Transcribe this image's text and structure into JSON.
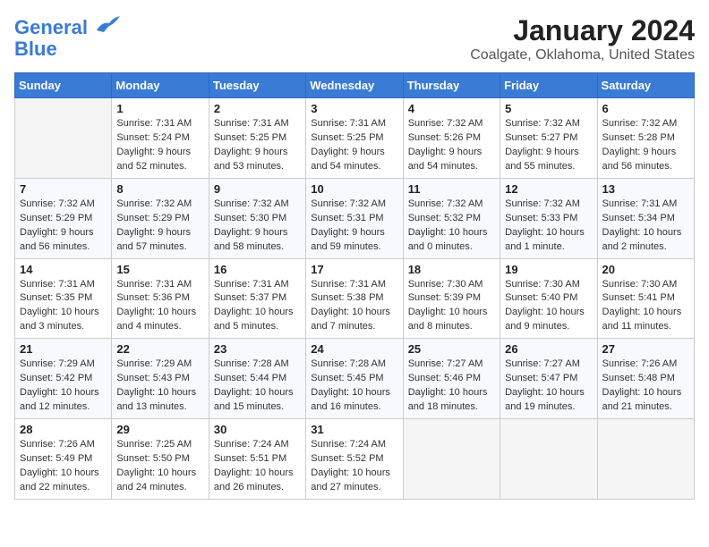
{
  "header": {
    "logo_line1": "General",
    "logo_line2": "Blue",
    "title": "January 2024",
    "subtitle": "Coalgate, Oklahoma, United States"
  },
  "days_of_week": [
    "Sunday",
    "Monday",
    "Tuesday",
    "Wednesday",
    "Thursday",
    "Friday",
    "Saturday"
  ],
  "weeks": [
    [
      {
        "day": "",
        "sunrise": "",
        "sunset": "",
        "daylight": ""
      },
      {
        "day": "1",
        "sunrise": "Sunrise: 7:31 AM",
        "sunset": "Sunset: 5:24 PM",
        "daylight": "Daylight: 9 hours and 52 minutes."
      },
      {
        "day": "2",
        "sunrise": "Sunrise: 7:31 AM",
        "sunset": "Sunset: 5:25 PM",
        "daylight": "Daylight: 9 hours and 53 minutes."
      },
      {
        "day": "3",
        "sunrise": "Sunrise: 7:31 AM",
        "sunset": "Sunset: 5:25 PM",
        "daylight": "Daylight: 9 hours and 54 minutes."
      },
      {
        "day": "4",
        "sunrise": "Sunrise: 7:32 AM",
        "sunset": "Sunset: 5:26 PM",
        "daylight": "Daylight: 9 hours and 54 minutes."
      },
      {
        "day": "5",
        "sunrise": "Sunrise: 7:32 AM",
        "sunset": "Sunset: 5:27 PM",
        "daylight": "Daylight: 9 hours and 55 minutes."
      },
      {
        "day": "6",
        "sunrise": "Sunrise: 7:32 AM",
        "sunset": "Sunset: 5:28 PM",
        "daylight": "Daylight: 9 hours and 56 minutes."
      }
    ],
    [
      {
        "day": "7",
        "sunrise": "Sunrise: 7:32 AM",
        "sunset": "Sunset: 5:29 PM",
        "daylight": "Daylight: 9 hours and 56 minutes."
      },
      {
        "day": "8",
        "sunrise": "Sunrise: 7:32 AM",
        "sunset": "Sunset: 5:29 PM",
        "daylight": "Daylight: 9 hours and 57 minutes."
      },
      {
        "day": "9",
        "sunrise": "Sunrise: 7:32 AM",
        "sunset": "Sunset: 5:30 PM",
        "daylight": "Daylight: 9 hours and 58 minutes."
      },
      {
        "day": "10",
        "sunrise": "Sunrise: 7:32 AM",
        "sunset": "Sunset: 5:31 PM",
        "daylight": "Daylight: 9 hours and 59 minutes."
      },
      {
        "day": "11",
        "sunrise": "Sunrise: 7:32 AM",
        "sunset": "Sunset: 5:32 PM",
        "daylight": "Daylight: 10 hours and 0 minutes."
      },
      {
        "day": "12",
        "sunrise": "Sunrise: 7:32 AM",
        "sunset": "Sunset: 5:33 PM",
        "daylight": "Daylight: 10 hours and 1 minute."
      },
      {
        "day": "13",
        "sunrise": "Sunrise: 7:31 AM",
        "sunset": "Sunset: 5:34 PM",
        "daylight": "Daylight: 10 hours and 2 minutes."
      }
    ],
    [
      {
        "day": "14",
        "sunrise": "Sunrise: 7:31 AM",
        "sunset": "Sunset: 5:35 PM",
        "daylight": "Daylight: 10 hours and 3 minutes."
      },
      {
        "day": "15",
        "sunrise": "Sunrise: 7:31 AM",
        "sunset": "Sunset: 5:36 PM",
        "daylight": "Daylight: 10 hours and 4 minutes."
      },
      {
        "day": "16",
        "sunrise": "Sunrise: 7:31 AM",
        "sunset": "Sunset: 5:37 PM",
        "daylight": "Daylight: 10 hours and 5 minutes."
      },
      {
        "day": "17",
        "sunrise": "Sunrise: 7:31 AM",
        "sunset": "Sunset: 5:38 PM",
        "daylight": "Daylight: 10 hours and 7 minutes."
      },
      {
        "day": "18",
        "sunrise": "Sunrise: 7:30 AM",
        "sunset": "Sunset: 5:39 PM",
        "daylight": "Daylight: 10 hours and 8 minutes."
      },
      {
        "day": "19",
        "sunrise": "Sunrise: 7:30 AM",
        "sunset": "Sunset: 5:40 PM",
        "daylight": "Daylight: 10 hours and 9 minutes."
      },
      {
        "day": "20",
        "sunrise": "Sunrise: 7:30 AM",
        "sunset": "Sunset: 5:41 PM",
        "daylight": "Daylight: 10 hours and 11 minutes."
      }
    ],
    [
      {
        "day": "21",
        "sunrise": "Sunrise: 7:29 AM",
        "sunset": "Sunset: 5:42 PM",
        "daylight": "Daylight: 10 hours and 12 minutes."
      },
      {
        "day": "22",
        "sunrise": "Sunrise: 7:29 AM",
        "sunset": "Sunset: 5:43 PM",
        "daylight": "Daylight: 10 hours and 13 minutes."
      },
      {
        "day": "23",
        "sunrise": "Sunrise: 7:28 AM",
        "sunset": "Sunset: 5:44 PM",
        "daylight": "Daylight: 10 hours and 15 minutes."
      },
      {
        "day": "24",
        "sunrise": "Sunrise: 7:28 AM",
        "sunset": "Sunset: 5:45 PM",
        "daylight": "Daylight: 10 hours and 16 minutes."
      },
      {
        "day": "25",
        "sunrise": "Sunrise: 7:27 AM",
        "sunset": "Sunset: 5:46 PM",
        "daylight": "Daylight: 10 hours and 18 minutes."
      },
      {
        "day": "26",
        "sunrise": "Sunrise: 7:27 AM",
        "sunset": "Sunset: 5:47 PM",
        "daylight": "Daylight: 10 hours and 19 minutes."
      },
      {
        "day": "27",
        "sunrise": "Sunrise: 7:26 AM",
        "sunset": "Sunset: 5:48 PM",
        "daylight": "Daylight: 10 hours and 21 minutes."
      }
    ],
    [
      {
        "day": "28",
        "sunrise": "Sunrise: 7:26 AM",
        "sunset": "Sunset: 5:49 PM",
        "daylight": "Daylight: 10 hours and 22 minutes."
      },
      {
        "day": "29",
        "sunrise": "Sunrise: 7:25 AM",
        "sunset": "Sunset: 5:50 PM",
        "daylight": "Daylight: 10 hours and 24 minutes."
      },
      {
        "day": "30",
        "sunrise": "Sunrise: 7:24 AM",
        "sunset": "Sunset: 5:51 PM",
        "daylight": "Daylight: 10 hours and 26 minutes."
      },
      {
        "day": "31",
        "sunrise": "Sunrise: 7:24 AM",
        "sunset": "Sunset: 5:52 PM",
        "daylight": "Daylight: 10 hours and 27 minutes."
      },
      {
        "day": "",
        "sunrise": "",
        "sunset": "",
        "daylight": ""
      },
      {
        "day": "",
        "sunrise": "",
        "sunset": "",
        "daylight": ""
      },
      {
        "day": "",
        "sunrise": "",
        "sunset": "",
        "daylight": ""
      }
    ]
  ]
}
